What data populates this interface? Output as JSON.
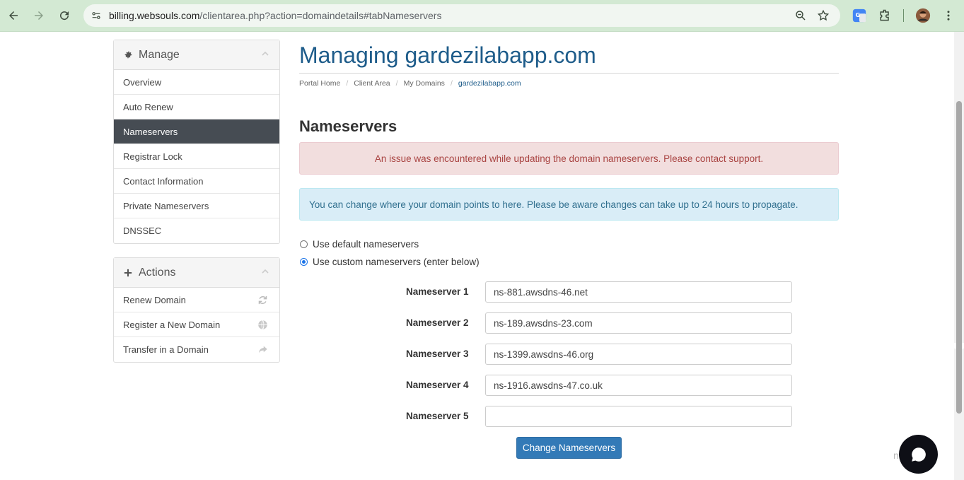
{
  "browser": {
    "url_host": "billing.websouls.com",
    "url_path": "/clientarea.php?action=domaindetails#tabNameservers"
  },
  "sidebar": {
    "manage": {
      "title": "Manage",
      "items": [
        {
          "label": "Overview"
        },
        {
          "label": "Auto Renew"
        },
        {
          "label": "Nameservers",
          "active": true
        },
        {
          "label": "Registrar Lock"
        },
        {
          "label": "Contact Information"
        },
        {
          "label": "Private Nameservers"
        },
        {
          "label": "DNSSEC"
        }
      ]
    },
    "actions": {
      "title": "Actions",
      "items": [
        {
          "label": "Renew Domain",
          "icon": "refresh-icon"
        },
        {
          "label": "Register a New Domain",
          "icon": "globe-icon"
        },
        {
          "label": "Transfer in a Domain",
          "icon": "share-arrow-icon"
        }
      ]
    }
  },
  "main": {
    "title": "Managing gardezilabapp.com",
    "breadcrumb": [
      "Portal Home",
      "Client Area",
      "My Domains",
      "gardezilabapp.com"
    ],
    "section_title": "Nameservers",
    "alert_error": "An issue was encountered while updating the domain nameservers. Please contact support.",
    "alert_info": "You can change where your domain points to here. Please be aware changes can take up to 24 hours to propagate.",
    "radio_default": "Use default nameservers",
    "radio_custom": "Use custom nameservers (enter below)",
    "selected_option": "custom",
    "nameservers": [
      {
        "label": "Nameserver 1",
        "value": "ns-881.awsdns-46.net"
      },
      {
        "label": "Nameserver 2",
        "value": "ns-189.awsdns-23.com"
      },
      {
        "label": "Nameserver 3",
        "value": "ns-1399.awsdns-46.org"
      },
      {
        "label": "Nameserver 4",
        "value": "ns-1916.awsdns-47.co.uk"
      },
      {
        "label": "Nameserver 5",
        "value": ""
      }
    ],
    "submit_label": "Change Nameservers"
  },
  "watermark": "ndows",
  "colors": {
    "brand": "#1e5c8a",
    "active_nav": "#464c53",
    "button": "#337ab7",
    "danger_bg": "#f2dede",
    "info_bg": "#d9edf7",
    "chrome": "#d3e9d3"
  }
}
